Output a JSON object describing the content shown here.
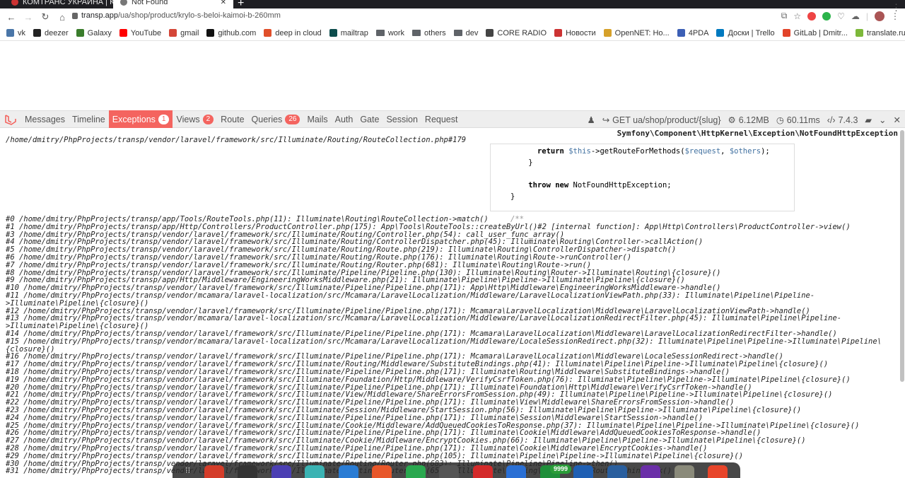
{
  "browser": {
    "tabs": [
      {
        "title": "КОМТРАНС УКРАИНА | К",
        "active": false
      },
      {
        "title": "Not Found",
        "active": true
      }
    ],
    "new_tab": "+",
    "url_host": "transp.app",
    "url_path": "/ua/shop/product/krylo-s-beloi-kaimoi-b-260mm"
  },
  "bookmarks": [
    {
      "label": "vk",
      "color": "#4a76a8"
    },
    {
      "label": "deezer",
      "color": "#222222"
    },
    {
      "label": "Galaxy",
      "color": "#3a7d2c"
    },
    {
      "label": "YouTube",
      "color": "#ff0000"
    },
    {
      "label": "gmail",
      "color": "#d44638"
    },
    {
      "label": "github.com",
      "color": "#111111"
    },
    {
      "label": "deep in cloud",
      "color": "#e04f2a"
    },
    {
      "label": "mailtrap",
      "color": "#0d4d4d"
    },
    {
      "label": "work",
      "color": "folder"
    },
    {
      "label": "others",
      "color": "folder"
    },
    {
      "label": "dev",
      "color": "folder"
    },
    {
      "label": "CORE RADIO",
      "color": "#444444"
    },
    {
      "label": "Новости",
      "color": "#cc3333"
    },
    {
      "label": "OpenNET: Ho...",
      "color": "#d6a12a"
    },
    {
      "label": "4PDA",
      "color": "#3c5fb5"
    },
    {
      "label": "Доски | Trello",
      "color": "#0079bf"
    },
    {
      "label": "GitLab | Dmitr...",
      "color": "#e24329"
    },
    {
      "label": "translate.ru",
      "color": "#7db83a"
    }
  ],
  "debugbar": {
    "tabs": [
      {
        "label": "Messages",
        "badge": ""
      },
      {
        "label": "Timeline",
        "badge": ""
      },
      {
        "label": "Exceptions",
        "badge": "1"
      },
      {
        "label": "Views",
        "badge": "2"
      },
      {
        "label": "Route",
        "badge": ""
      },
      {
        "label": "Queries",
        "badge": "26"
      },
      {
        "label": "Mails",
        "badge": ""
      },
      {
        "label": "Auth",
        "badge": ""
      },
      {
        "label": "Gate",
        "badge": ""
      },
      {
        "label": "Session",
        "badge": ""
      },
      {
        "label": "Request",
        "badge": ""
      }
    ],
    "active_tab": "Exceptions",
    "route": "GET ua/shop/product/{slug}",
    "memory": "6.12MB",
    "time": "60.11ms",
    "php_version": "7.4.3"
  },
  "exception": {
    "class": "Symfony\\Component\\HttpKernel\\Exception\\NotFoundHttpException",
    "file": "/home/dmitry/PhpProjects/transp/vendor/laravel/framework/src/Illuminate/Routing/RouteCollection.php#179",
    "code": {
      "line1_kw": "return ",
      "line1_var1": "$this",
      "line1_mid": "->getRouteForMethods(",
      "line1_var2": "$request",
      "line1_sep": ", ",
      "line1_var3": "$others",
      "line1_end": ");",
      "line2": "}",
      "line4_kw": "throw new ",
      "line4_rest": "NotFoundHttpException;",
      "line5": "}",
      "line7": "/**"
    },
    "trace": [
      "#0 /home/dmitry/PhpProjects/transp/app/Tools/RouteTools.php(11): Illuminate\\Routing\\RouteCollection->match()",
      "#1 /home/dmitry/PhpProjects/transp/app/Http/Controllers/ProductController.php(175): App\\Tools\\RouteTools::createByUrl()#2 [internal function]: App\\Http\\Controllers\\ProductController->view()",
      "#3 /home/dmitry/PhpProjects/transp/vendor/laravel/framework/src/Illuminate/Routing/Controller.php(54): call_user_func_array()",
      "#4 /home/dmitry/PhpProjects/transp/vendor/laravel/framework/src/Illuminate/Routing/ControllerDispatcher.php(45): Illuminate\\Routing\\Controller->callAction()",
      "#5 /home/dmitry/PhpProjects/transp/vendor/laravel/framework/src/Illuminate/Routing/Route.php(219): Illuminate\\Routing\\ControllerDispatcher->dispatch()",
      "#6 /home/dmitry/PhpProjects/transp/vendor/laravel/framework/src/Illuminate/Routing/Route.php(176): Illuminate\\Routing\\Route->runController()",
      "#7 /home/dmitry/PhpProjects/transp/vendor/laravel/framework/src/Illuminate/Routing/Router.php(681): Illuminate\\Routing\\Route->run()",
      "#8 /home/dmitry/PhpProjects/transp/vendor/laravel/framework/src/Illuminate/Pipeline/Pipeline.php(130): Illuminate\\Routing\\Router->Illuminate\\Routing\\{closure}()",
      "#9 /home/dmitry/PhpProjects/transp/app/Http/Middleware/EngineeringWorksMiddleware.php(21): Illuminate\\Pipeline\\Pipeline->Illuminate\\Pipeline\\{closure}()",
      "#10 /home/dmitry/PhpProjects/transp/vendor/laravel/framework/src/Illuminate/Pipeline/Pipeline.php(171): App\\Http\\Middleware\\EngineeringWorksMiddleware->handle()",
      "#11 /home/dmitry/PhpProjects/transp/vendor/mcamara/laravel-localization/src/Mcamara/LaravelLocalization/Middleware/LaravelLocalizationViewPath.php(33): Illuminate\\Pipeline\\Pipeline->Illuminate\\Pipeline\\{closure}()",
      "#12 /home/dmitry/PhpProjects/transp/vendor/laravel/framework/src/Illuminate/Pipeline/Pipeline.php(171): Mcamara\\LaravelLocalization\\Middleware\\LaravelLocalizationViewPath->handle()",
      "#13 /home/dmitry/PhpProjects/transp/vendor/mcamara/laravel-localization/src/Mcamara/LaravelLocalization/Middleware/LaravelLocalizationRedirectFilter.php(45): Illuminate\\Pipeline\\Pipeline->Illuminate\\Pipeline\\{closure}()",
      "#14 /home/dmitry/PhpProjects/transp/vendor/laravel/framework/src/Illuminate/Pipeline/Pipeline.php(171): Mcamara\\LaravelLocalization\\Middleware\\LaravelLocalizationRedirectFilter->handle()",
      "#15 /home/dmitry/PhpProjects/transp/vendor/mcamara/laravel-localization/src/Mcamara/LaravelLocalization/Middleware/LocaleSessionRedirect.php(32): Illuminate\\Pipeline\\Pipeline->Illuminate\\Pipeline\\{closure}()",
      "#16 /home/dmitry/PhpProjects/transp/vendor/laravel/framework/src/Illuminate/Pipeline/Pipeline.php(171): Mcamara\\LaravelLocalization\\Middleware\\LocaleSessionRedirect->handle()",
      "#17 /home/dmitry/PhpProjects/transp/vendor/laravel/framework/src/Illuminate/Routing/Middleware/SubstituteBindings.php(41): Illuminate\\Pipeline\\Pipeline->Illuminate\\Pipeline\\{closure}()",
      "#18 /home/dmitry/PhpProjects/transp/vendor/laravel/framework/src/Illuminate/Pipeline/Pipeline.php(171): Illuminate\\Routing\\Middleware\\SubstituteBindings->handle()",
      "#19 /home/dmitry/PhpProjects/transp/vendor/laravel/framework/src/Illuminate/Foundation/Http/Middleware/VerifyCsrfToken.php(76): Illuminate\\Pipeline\\Pipeline->Illuminate\\Pipeline\\{closure}()",
      "#20 /home/dmitry/PhpProjects/transp/vendor/laravel/framework/src/Illuminate/Pipeline/Pipeline.php(171): Illuminate\\Foundation\\Http\\Middleware\\VerifyCsrfToken->handle()",
      "#21 /home/dmitry/PhpProjects/transp/vendor/laravel/framework/src/Illuminate/View/Middleware/ShareErrorsFromSession.php(49): Illuminate\\Pipeline\\Pipeline->Illuminate\\Pipeline\\{closure}()",
      "#22 /home/dmitry/PhpProjects/transp/vendor/laravel/framework/src/Illuminate/Pipeline/Pipeline.php(171): Illuminate\\View\\Middleware\\ShareErrorsFromSession->handle()",
      "#23 /home/dmitry/PhpProjects/transp/vendor/laravel/framework/src/Illuminate/Session/Middleware/StartSession.php(56): Illuminate\\Pipeline\\Pipeline->Illuminate\\Pipeline\\{closure}()",
      "#24 /home/dmitry/PhpProjects/transp/vendor/laravel/framework/src/Illuminate/Pipeline/Pipeline.php(171): Illuminate\\Session\\Middleware\\StartSession->handle()",
      "#25 /home/dmitry/PhpProjects/transp/vendor/laravel/framework/src/Illuminate/Cookie/Middleware/AddQueuedCookiesToResponse.php(37): Illuminate\\Pipeline\\Pipeline->Illuminate\\Pipeline\\{closure}()",
      "#26 /home/dmitry/PhpProjects/transp/vendor/laravel/framework/src/Illuminate/Pipeline/Pipeline.php(171): Illuminate\\Cookie\\Middleware\\AddQueuedCookiesToResponse->handle()",
      "#27 /home/dmitry/PhpProjects/transp/vendor/laravel/framework/src/Illuminate/Cookie/Middleware/EncryptCookies.php(66): Illuminate\\Pipeline\\Pipeline->Illuminate\\Pipeline\\{closure}()",
      "#28 /home/dmitry/PhpProjects/transp/vendor/laravel/framework/src/Illuminate/Pipeline/Pipeline.php(171): Illuminate\\Cookie\\Middleware\\EncryptCookies->handle()",
      "#29 /home/dmitry/PhpProjects/transp/vendor/laravel/framework/src/Illuminate/Pipeline/Pipeline.php(105): Illuminate\\Pipeline\\Pipeline->Illuminate\\Pipeline\\{closure}()",
      "#30 /home/dmitry/PhpProjects/transp/vendor/laravel/framework/src/Illuminate/Routing/Router.php(683): Illuminate\\Pipeline\\Pipeline->then()",
      "#31 /home/dmitry/PhpProjects/transp/vendor/laravel/framework/src/Illuminate/Routing/Router.php(658): Illuminate\\Routing\\Router->runRouteWithinStack()"
    ]
  },
  "dock": {
    "apps": [
      "#d43d2a",
      "#333333",
      "#4b3fb3",
      "#3bb3b3",
      "#2a7cd4",
      "#e8572a",
      "#2aa84f",
      "#555555",
      "#d42a2a",
      "#2a6fd4",
      "#1f8f3a",
      "#1f5fb3",
      "#2a5f9e",
      "#6b2fa8",
      "#8a8a7a",
      "#e8452a"
    ],
    "badge": "9999"
  }
}
